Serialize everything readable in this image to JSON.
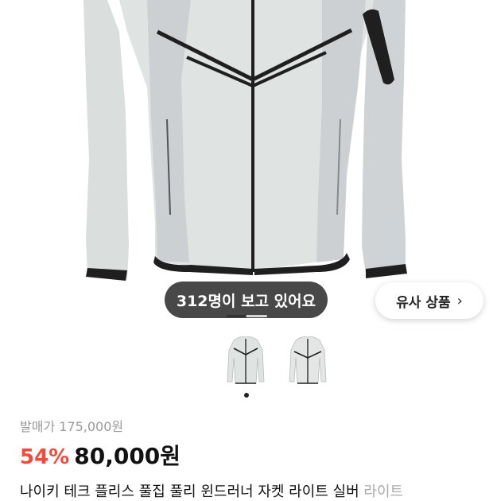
{
  "hero": {
    "image_alt": "light gray tech fleece windrunner jacket",
    "viewer_badge": "312명이 보고 있어요",
    "similar_button": "유사 상품",
    "similar_chevron": "›"
  },
  "carousel": {
    "current_index": 1,
    "total": 2
  },
  "price": {
    "list_price_text": "발매가 175,000원",
    "discount": "54%",
    "sale_price": "80,000원"
  },
  "product": {
    "title": "나이키 테크 플리스 풀집 풀리 윈드러너 자켓 라이트 실버",
    "variant": "라이트"
  },
  "colors": {
    "discount": "#f24a3a",
    "jacket_body": "#dfe3e1",
    "jacket_panel": "#cdd0d3",
    "trim": "#1f1f1f"
  },
  "icons": [
    "chevron-right-icon"
  ]
}
